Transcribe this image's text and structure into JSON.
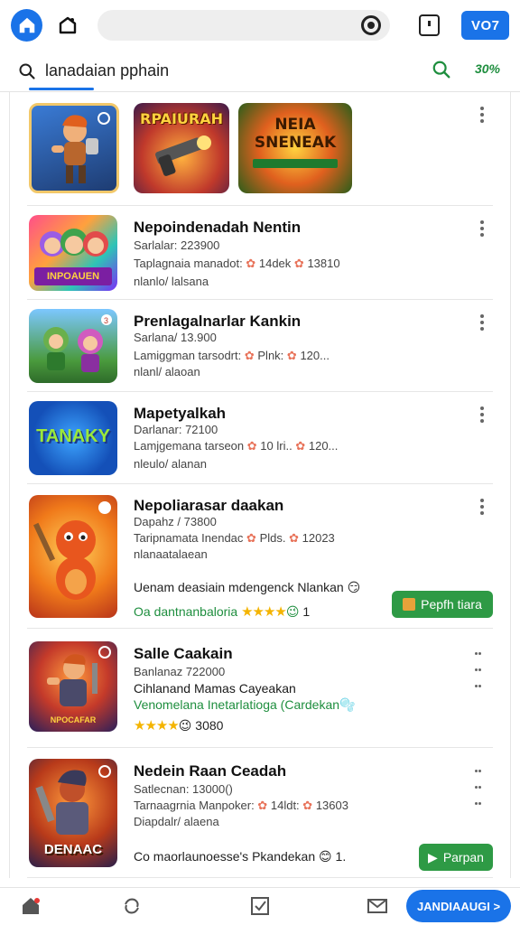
{
  "topbar": {
    "action_label": "VO7"
  },
  "search": {
    "query": "lanadaian pphain",
    "right_value": "30%"
  },
  "featured": {
    "tile2_title": "RPAIURAH",
    "tile3_title": "NEIA SNENEAK"
  },
  "apps": [
    {
      "title": "Nepoindenadah Nentin",
      "line1": "Sarlalar: 223900",
      "line2a": "Taplagnaia manadot:",
      "line2b": "14dek",
      "line2c": "13810",
      "line3": "nlanlo/ lalsana",
      "thumb_text": "INPOAUEN"
    },
    {
      "title": "Prenlagalnarlar Kankin",
      "line1": "Sarlana/ 13.900",
      "line2a": "Lamiggman tarsodrt:",
      "line2b": "Plnk:",
      "line2c": "120...",
      "line3": "nlanl/ alaoan"
    },
    {
      "title": "Mapetyalkah",
      "line1": "Darlanar: 72100",
      "line2a": "Lamjgemana tarseon",
      "line2b": "10 lri..",
      "line2c": "120...",
      "line3": "nleulo/ alanan",
      "thumb_text": "TANAKY"
    },
    {
      "title": "Nepoliarasar daakan",
      "line1": "Dapahz / 73800",
      "line2a": "Taripnamata Inendac",
      "line2b": "Plds.",
      "line2c": "12023",
      "line3": "nlanaatalaean",
      "note": "Uenam deasiain mdengenck Nlankan",
      "green_note": "Oa dantnanbaloria",
      "rating": "1",
      "button": "Pepfh tiara"
    },
    {
      "title": "Salle Caakain",
      "line1": "Banlanaz 722000",
      "line2": "Cihlanand Mamas Cayeakan",
      "line3": "Venomelana Inetarlatioga (Cardekan",
      "rating": "3080",
      "thumb_text": "NPOCAFAR"
    },
    {
      "title": "Nedein Raan Ceadah",
      "line1": "Satlecnan: 13000()",
      "line2a": "Tarnaagrnia Manpoker:",
      "line2b": "14ldt:",
      "line2c": "13603",
      "line3": "Diapdalr/ alaena",
      "note": "Co maorlaunoesse's Pkandekan",
      "rating": "1.",
      "button": "Parpan",
      "thumb_text": "DENAAC"
    }
  ],
  "bottomnav": {
    "cta_label": "JANDIAAUGI >"
  }
}
